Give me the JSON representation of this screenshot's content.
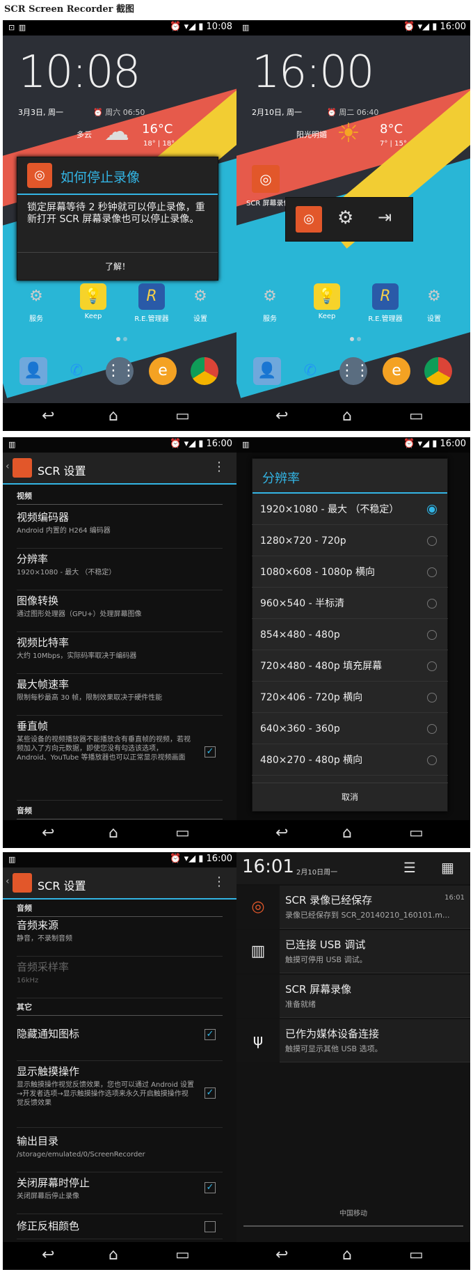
{
  "page_title": "SCR Screen Recorder 截图",
  "status": {
    "time1": "10:08",
    "time2": "16:00"
  },
  "home1": {
    "clock": "10:08",
    "date": "3月3日, 周一",
    "alarm": "周六 06:50",
    "weather_desc": "多云",
    "temp": "16°C",
    "range": "18° | 18°"
  },
  "home2": {
    "clock": "16:00",
    "date": "2月10日, 周一",
    "alarm": "周二 06:40",
    "weather_desc": "阳光明媚",
    "temp": "8°C",
    "range": "7° | 15°",
    "app_label": "SCR 屏幕录像"
  },
  "apps": {
    "services": "服务",
    "keep": "Keep",
    "re": "R.E.管理器",
    "settings": "设置"
  },
  "stop_dialog": {
    "title": "如何停止录像",
    "body": "锁定屏幕等待 2 秒钟就可以停止录像，重新打开 SCR 屏幕录像也可以停止录像。",
    "ok": "了解！"
  },
  "settings": {
    "title": "SCR 设置",
    "video_section": "视频",
    "encoder_title": "视频编码器",
    "encoder_sub": "Android 内置的 H264 编码器",
    "res_title": "分辨率",
    "res_sub": "1920×1080 - 最大 （不稳定）",
    "transform_title": "图像转换",
    "transform_sub": "通过图形处理器（GPU+）处理屏幕图像",
    "bitrate_title": "视频比特率",
    "bitrate_sub": "大约 10Mbps，实际码率取决于编码器",
    "fps_title": "最大帧速率",
    "fps_sub": "限制每秒最高 30 帧，限制效果取决于硬件性能",
    "vflip_title": "垂直帧",
    "vflip_sub": "某些设备的视频播放器不能播放含有垂直帧的视频，若视频加入了方向元数据，即使您没有勾选该选项，Android、YouTube 等播放器也可以正常显示视频画面",
    "audio_section": "音频"
  },
  "resolution_dialog": {
    "title": "分辨率",
    "options": [
      "1920×1080 - 最大 （不稳定）",
      "1280×720 - 720p",
      "1080×608 - 1080p 横向",
      "960×540 - 半标清",
      "854×480 - 480p",
      "720×480 - 480p 填充屏幕",
      "720×406 - 720p 横向",
      "640×360 - 360p",
      "480×270 - 480p 横向"
    ],
    "selected": 0,
    "cancel": "取消"
  },
  "settings2": {
    "title": "SCR 设置",
    "audio_section": "音频",
    "source_title": "音频来源",
    "source_sub": "静音，不录制音频",
    "rate_title": "音频采样率",
    "rate_sub": "16kHz",
    "other_section": "其它",
    "hide_title": "隐藏通知图标",
    "touch_title": "显示触摸操作",
    "touch_sub": "显示触摸操作视觉反馈效果，您也可以通过 Android 设置→开发者选项→显示触摸操作选项来永久开启触摸操作视觉反馈效果",
    "out_title": "输出目录",
    "out_sub": "/storage/emulated/0/ScreenRecorder",
    "stop_title": "关闭屏幕时停止",
    "stop_sub": "关闭屏幕后停止录像",
    "invert_title": "修正反相颜色"
  },
  "notifications": {
    "time": "16:01",
    "date": "2月10日周一",
    "items": [
      {
        "title": "SCR 录像已经保存",
        "sub": "录像已经保存到 SCR_20140210_160101.m...",
        "time": "16:01"
      },
      {
        "title": "已连接 USB 调试",
        "sub": "触摸可停用 USB 调试。",
        "time": ""
      },
      {
        "title": "SCR 屏幕录像",
        "sub": "准备就绪",
        "time": ""
      },
      {
        "title": "已作为媒体设备连接",
        "sub": "触摸可显示其他 USB 选项。",
        "time": ""
      }
    ],
    "carrier": "中国移动"
  }
}
